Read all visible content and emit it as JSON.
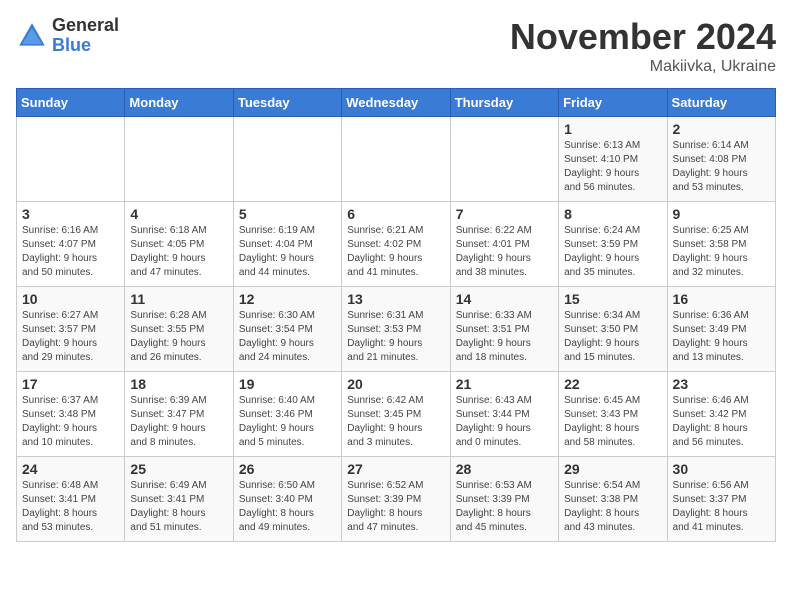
{
  "header": {
    "logo_general": "General",
    "logo_blue": "Blue",
    "month_title": "November 2024",
    "location": "Makiivka, Ukraine"
  },
  "weekdays": [
    "Sunday",
    "Monday",
    "Tuesday",
    "Wednesday",
    "Thursday",
    "Friday",
    "Saturday"
  ],
  "weeks": [
    [
      {
        "day": "",
        "info": ""
      },
      {
        "day": "",
        "info": ""
      },
      {
        "day": "",
        "info": ""
      },
      {
        "day": "",
        "info": ""
      },
      {
        "day": "",
        "info": ""
      },
      {
        "day": "1",
        "info": "Sunrise: 6:13 AM\nSunset: 4:10 PM\nDaylight: 9 hours\nand 56 minutes."
      },
      {
        "day": "2",
        "info": "Sunrise: 6:14 AM\nSunset: 4:08 PM\nDaylight: 9 hours\nand 53 minutes."
      }
    ],
    [
      {
        "day": "3",
        "info": "Sunrise: 6:16 AM\nSunset: 4:07 PM\nDaylight: 9 hours\nand 50 minutes."
      },
      {
        "day": "4",
        "info": "Sunrise: 6:18 AM\nSunset: 4:05 PM\nDaylight: 9 hours\nand 47 minutes."
      },
      {
        "day": "5",
        "info": "Sunrise: 6:19 AM\nSunset: 4:04 PM\nDaylight: 9 hours\nand 44 minutes."
      },
      {
        "day": "6",
        "info": "Sunrise: 6:21 AM\nSunset: 4:02 PM\nDaylight: 9 hours\nand 41 minutes."
      },
      {
        "day": "7",
        "info": "Sunrise: 6:22 AM\nSunset: 4:01 PM\nDaylight: 9 hours\nand 38 minutes."
      },
      {
        "day": "8",
        "info": "Sunrise: 6:24 AM\nSunset: 3:59 PM\nDaylight: 9 hours\nand 35 minutes."
      },
      {
        "day": "9",
        "info": "Sunrise: 6:25 AM\nSunset: 3:58 PM\nDaylight: 9 hours\nand 32 minutes."
      }
    ],
    [
      {
        "day": "10",
        "info": "Sunrise: 6:27 AM\nSunset: 3:57 PM\nDaylight: 9 hours\nand 29 minutes."
      },
      {
        "day": "11",
        "info": "Sunrise: 6:28 AM\nSunset: 3:55 PM\nDaylight: 9 hours\nand 26 minutes."
      },
      {
        "day": "12",
        "info": "Sunrise: 6:30 AM\nSunset: 3:54 PM\nDaylight: 9 hours\nand 24 minutes."
      },
      {
        "day": "13",
        "info": "Sunrise: 6:31 AM\nSunset: 3:53 PM\nDaylight: 9 hours\nand 21 minutes."
      },
      {
        "day": "14",
        "info": "Sunrise: 6:33 AM\nSunset: 3:51 PM\nDaylight: 9 hours\nand 18 minutes."
      },
      {
        "day": "15",
        "info": "Sunrise: 6:34 AM\nSunset: 3:50 PM\nDaylight: 9 hours\nand 15 minutes."
      },
      {
        "day": "16",
        "info": "Sunrise: 6:36 AM\nSunset: 3:49 PM\nDaylight: 9 hours\nand 13 minutes."
      }
    ],
    [
      {
        "day": "17",
        "info": "Sunrise: 6:37 AM\nSunset: 3:48 PM\nDaylight: 9 hours\nand 10 minutes."
      },
      {
        "day": "18",
        "info": "Sunrise: 6:39 AM\nSunset: 3:47 PM\nDaylight: 9 hours\nand 8 minutes."
      },
      {
        "day": "19",
        "info": "Sunrise: 6:40 AM\nSunset: 3:46 PM\nDaylight: 9 hours\nand 5 minutes."
      },
      {
        "day": "20",
        "info": "Sunrise: 6:42 AM\nSunset: 3:45 PM\nDaylight: 9 hours\nand 3 minutes."
      },
      {
        "day": "21",
        "info": "Sunrise: 6:43 AM\nSunset: 3:44 PM\nDaylight: 9 hours\nand 0 minutes."
      },
      {
        "day": "22",
        "info": "Sunrise: 6:45 AM\nSunset: 3:43 PM\nDaylight: 8 hours\nand 58 minutes."
      },
      {
        "day": "23",
        "info": "Sunrise: 6:46 AM\nSunset: 3:42 PM\nDaylight: 8 hours\nand 56 minutes."
      }
    ],
    [
      {
        "day": "24",
        "info": "Sunrise: 6:48 AM\nSunset: 3:41 PM\nDaylight: 8 hours\nand 53 minutes."
      },
      {
        "day": "25",
        "info": "Sunrise: 6:49 AM\nSunset: 3:41 PM\nDaylight: 8 hours\nand 51 minutes."
      },
      {
        "day": "26",
        "info": "Sunrise: 6:50 AM\nSunset: 3:40 PM\nDaylight: 8 hours\nand 49 minutes."
      },
      {
        "day": "27",
        "info": "Sunrise: 6:52 AM\nSunset: 3:39 PM\nDaylight: 8 hours\nand 47 minutes."
      },
      {
        "day": "28",
        "info": "Sunrise: 6:53 AM\nSunset: 3:39 PM\nDaylight: 8 hours\nand 45 minutes."
      },
      {
        "day": "29",
        "info": "Sunrise: 6:54 AM\nSunset: 3:38 PM\nDaylight: 8 hours\nand 43 minutes."
      },
      {
        "day": "30",
        "info": "Sunrise: 6:56 AM\nSunset: 3:37 PM\nDaylight: 8 hours\nand 41 minutes."
      }
    ]
  ]
}
